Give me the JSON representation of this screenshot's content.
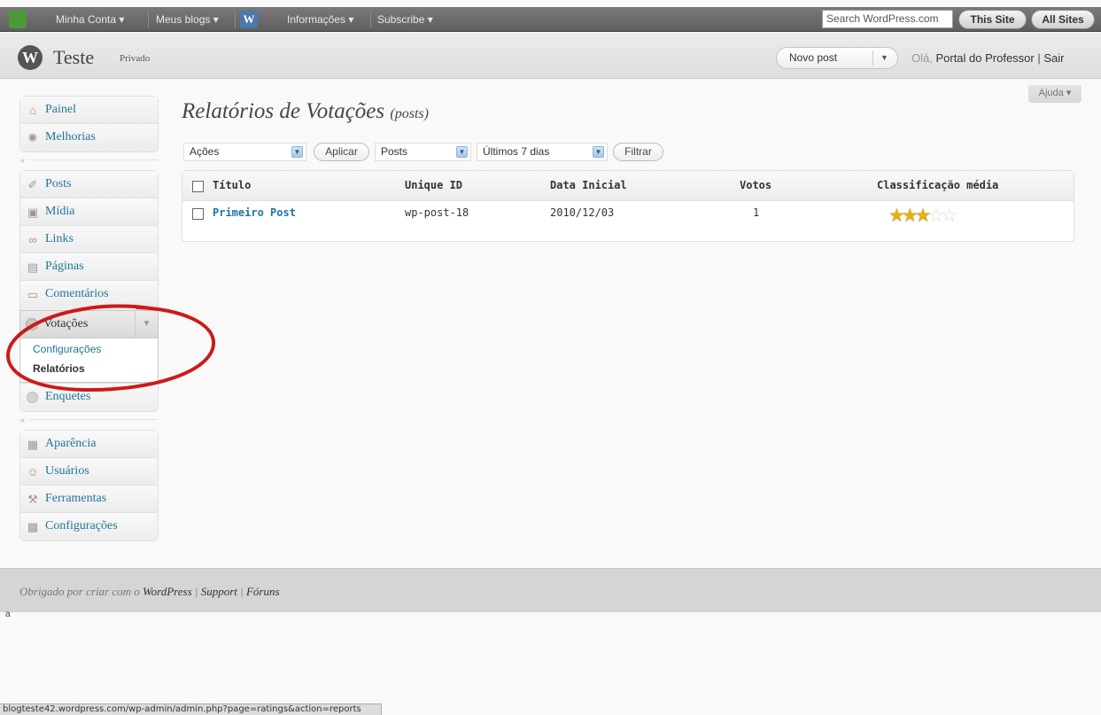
{
  "admin_bar": {
    "minha_conta": "Minha Conta ▾",
    "meus_blogs": "Meus blogs ▾",
    "informacoes": "Informações ▾",
    "subscribe": "Subscribe ▾",
    "search_placeholder": "Search WordPress.com",
    "this_site": "This Site",
    "all_sites": "All Sites"
  },
  "header": {
    "site_title": "Teste",
    "privacy": "Privado",
    "novo_post": "Novo post",
    "greeting_prefix": "Olá,",
    "user_name": "Portal do Professor",
    "separator": "|",
    "logout": "Sair",
    "help": "Ajuda ▾"
  },
  "sidebar": {
    "group1": [
      {
        "label": "Painel",
        "icon": "home-icon"
      },
      {
        "label": "Melhorias",
        "icon": "gear-icon"
      }
    ],
    "group2": [
      {
        "label": "Posts",
        "icon": "pushpin-icon"
      },
      {
        "label": "Mídia",
        "icon": "media-icon"
      },
      {
        "label": "Links",
        "icon": "link-icon"
      },
      {
        "label": "Páginas",
        "icon": "pages-icon"
      },
      {
        "label": "Comentários",
        "icon": "comment-icon"
      }
    ],
    "votacoes": {
      "label": "Votações",
      "submenu": [
        "Configurações",
        "Relatórios"
      ]
    },
    "enquetes": "Enquetes",
    "group3": [
      {
        "label": "Aparência",
        "icon": "appearance-icon"
      },
      {
        "label": "Usuários",
        "icon": "users-icon"
      },
      {
        "label": "Ferramentas",
        "icon": "tools-icon"
      },
      {
        "label": "Configurações",
        "icon": "settings-icon"
      }
    ]
  },
  "main": {
    "title": "Relatórios de Votações",
    "title_suffix": "(posts)",
    "filters": {
      "acoes": "Ações",
      "aplicar": "Aplicar",
      "posts": "Posts",
      "periodo": "Últimos 7 dias",
      "filtrar": "Filtrar"
    },
    "table": {
      "columns": [
        "Título",
        "Unique ID",
        "Data Inicial",
        "Votos",
        "Classificação média"
      ],
      "rows": [
        {
          "titulo": "Primeiro Post",
          "unique_id": "wp-post-18",
          "data_inicial": "2010/12/03",
          "votos": "1",
          "rating": 3,
          "rating_max": 5
        }
      ]
    }
  },
  "footer": {
    "prefix": "Obrigado por criar com o",
    "wordpress": "WordPress",
    "sep1": "|",
    "support": "Support",
    "sep2": "|",
    "foruns": "Fóruns",
    "mark": "a"
  },
  "status_bar": "blogteste42.wordpress.com/wp-admin/admin.php?page=ratings&action=reports",
  "colors": {
    "link": "#21759b",
    "annotation": "#cc1a1a",
    "star": "#e4b115"
  }
}
